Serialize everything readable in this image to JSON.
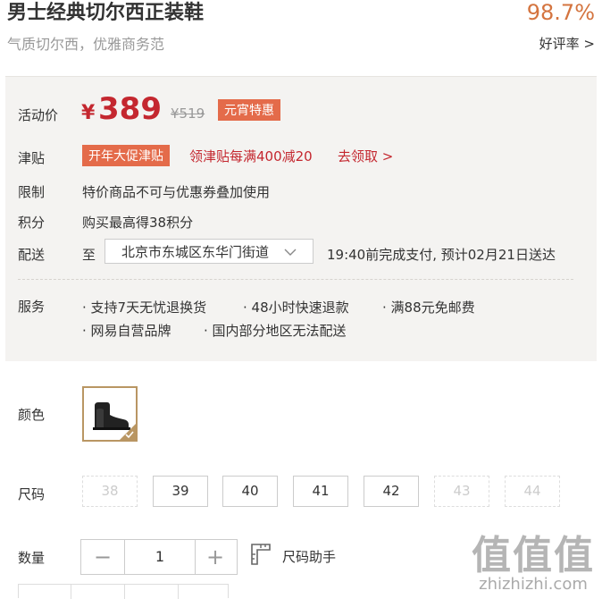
{
  "product": {
    "title": "男士经典切尔西正装鞋",
    "subtitle": "气质切尔西，优雅商务范"
  },
  "rating": {
    "value": "98.7%",
    "link_label": "好评率 >"
  },
  "price": {
    "label": "活动价",
    "currency": "¥",
    "current": "389",
    "original": "¥519",
    "badge": "元宵特惠"
  },
  "subsidy": {
    "label": "津贴",
    "badge": "开年大促津贴",
    "text": "领津贴每满400减20",
    "link": "去领取 >"
  },
  "limit": {
    "label": "限制",
    "text": "特价商品不可与优惠券叠加使用"
  },
  "points": {
    "label": "积分",
    "text": "购买最高得38积分"
  },
  "delivery": {
    "label": "配送",
    "to": "至",
    "address": "北京市东城区东华门街道",
    "eta": "19:40前完成支付, 预计02月21日送达"
  },
  "service": {
    "label": "服务",
    "items": [
      "· 支持7天无忧退换货",
      "· 48小时快速退款",
      "· 满88元免邮费",
      "· 网易自营品牌",
      "· 国内部分地区无法配送"
    ]
  },
  "color": {
    "label": "颜色"
  },
  "size": {
    "label": "尺码",
    "options": [
      "38",
      "39",
      "40",
      "41",
      "42",
      "43",
      "44"
    ],
    "disabled": [
      "38",
      "43",
      "44"
    ]
  },
  "quantity": {
    "label": "数量",
    "minus": "−",
    "value": "1",
    "plus": "+",
    "size_helper": "尺码助手"
  },
  "watermark": {
    "big": "值值值",
    "small": "zhizhizhi.com"
  },
  "colors": {
    "accent_red": "#c4272f",
    "badge_orange": "#e46b4a",
    "rating_orange": "#d4743f",
    "swatch_border": "#b99663"
  }
}
